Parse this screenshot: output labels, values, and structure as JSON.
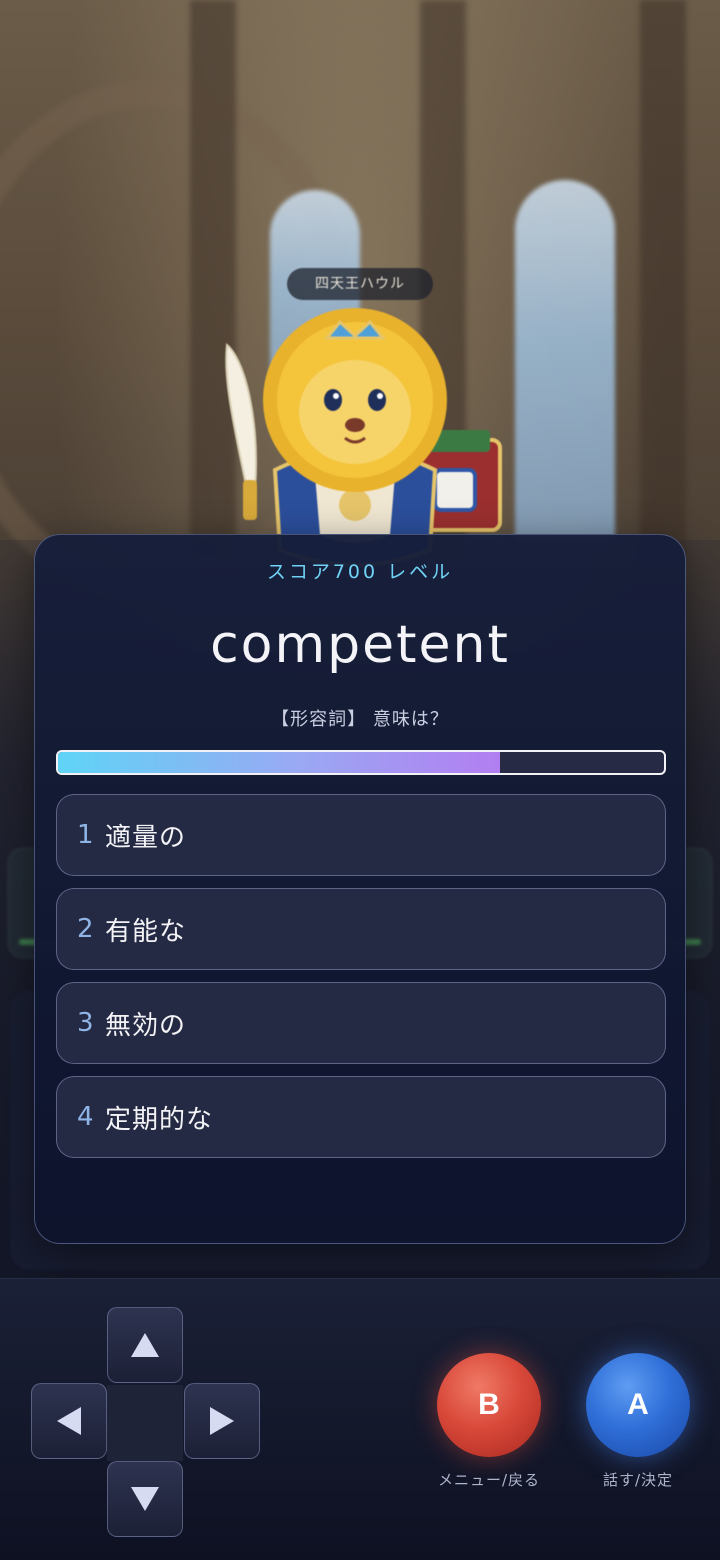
{
  "scene": {
    "speaker_name": "四天王ハウル"
  },
  "quiz": {
    "level_label": "スコア700 レベル",
    "word": "competent",
    "prompt": "【形容詞】 意味は？",
    "timer_remaining_fraction": 0.73,
    "options": [
      {
        "number": "1",
        "text": "適量の"
      },
      {
        "number": "2",
        "text": "有能な"
      },
      {
        "number": "3",
        "text": "無効の"
      },
      {
        "number": "4",
        "text": "定期的な"
      }
    ]
  },
  "controls": {
    "b_button": {
      "label": "B",
      "caption": "メニュー/戻る"
    },
    "a_button": {
      "label": "A",
      "caption": "話す/決定"
    }
  },
  "colors": {
    "level_accent": "#6fd3f5",
    "timer_gradient": [
      "#5fd4f6",
      "#b27ef1"
    ],
    "b_button": "#d9493a",
    "a_button": "#2f6fd8"
  }
}
